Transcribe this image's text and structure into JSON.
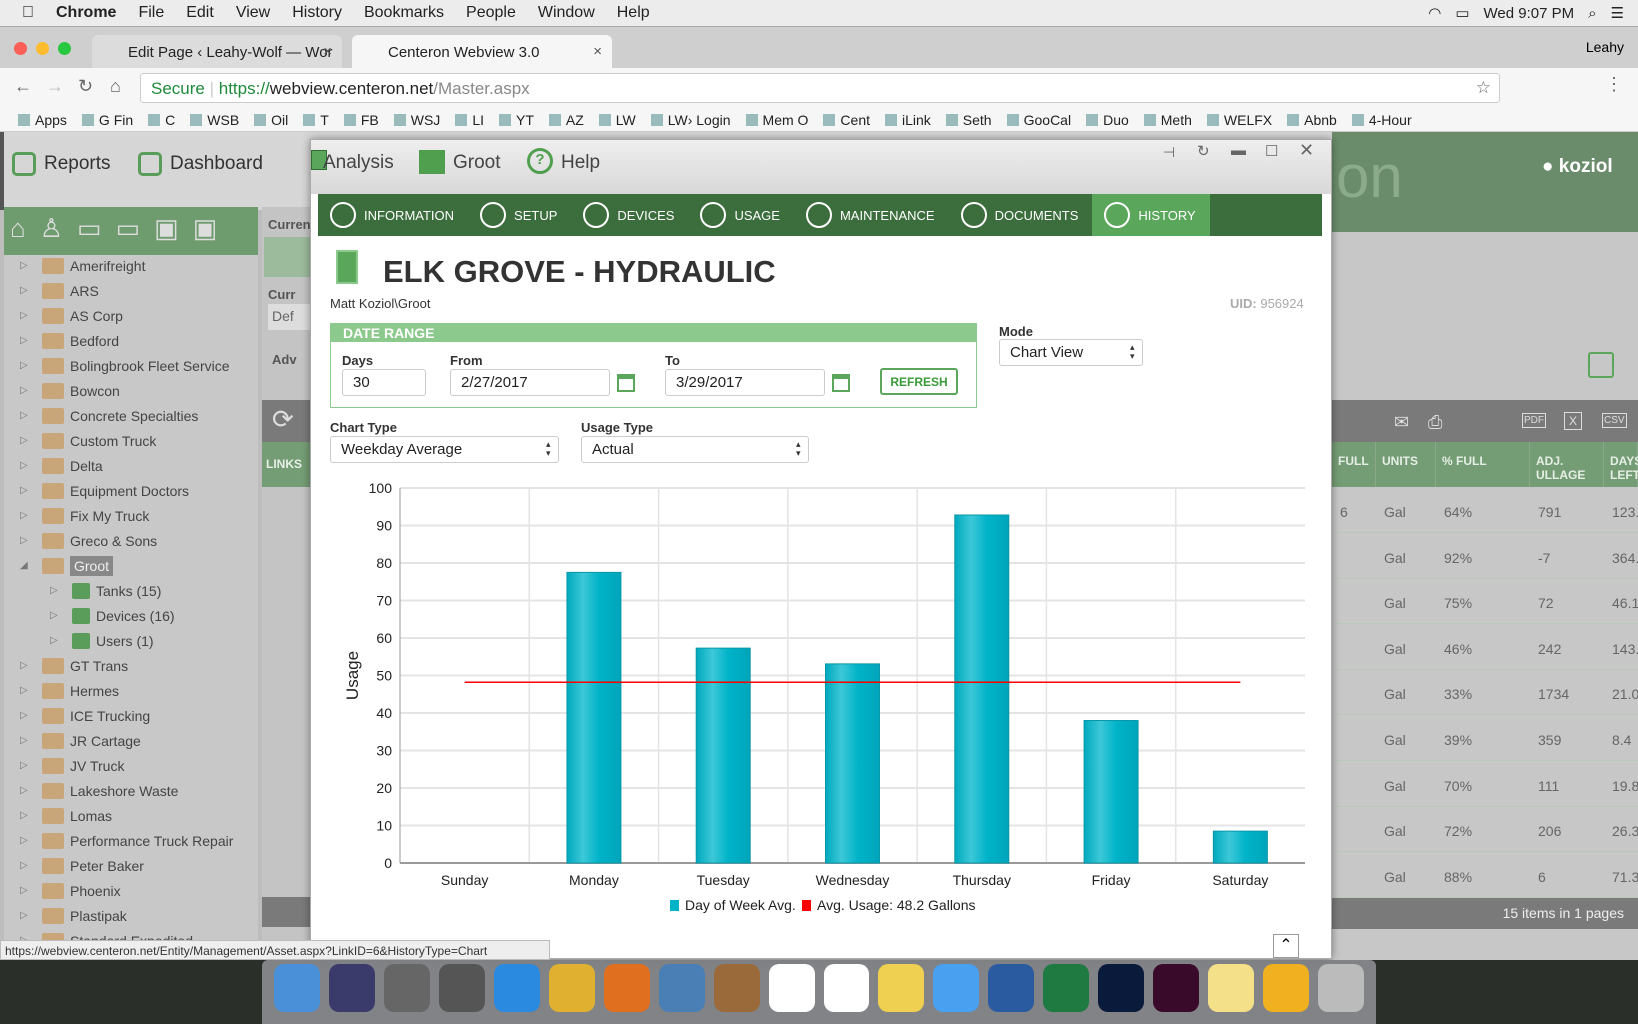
{
  "menubar": {
    "app": "Chrome",
    "items": [
      "File",
      "Edit",
      "View",
      "History",
      "Bookmarks",
      "People",
      "Window",
      "Help"
    ],
    "clock": "Wed 9:07 PM"
  },
  "browser": {
    "tabs": [
      {
        "title": "Edit Page ‹ Leahy-Wolf — Wor"
      },
      {
        "title": "Centeron Webview 3.0"
      }
    ],
    "profile": "Leahy",
    "secure_label": "Secure",
    "url_scheme": "https://",
    "url_host": "webview.centeron.net",
    "url_path": "/Master.aspx",
    "bookmarks": [
      "Apps",
      "G Fin",
      "C",
      "WSB",
      "Oil",
      "T",
      "FB",
      "WSJ",
      "LI",
      "YT",
      "AZ",
      "LW",
      "LW› Login",
      "Mem O",
      "Cent",
      "iLink",
      "Seth",
      "GooCal",
      "Duo",
      "Meth",
      "WELFX",
      "Abnb",
      "4-Hour"
    ],
    "status_url": "https://webview.centeron.net/Entity/Management/Asset.aspx?LinkID=6&HistoryType=Chart"
  },
  "app": {
    "nav": [
      "Reports",
      "Dashboard"
    ],
    "brand_partial": "on",
    "user": "koziol",
    "tree": [
      {
        "label": "Amerifreight"
      },
      {
        "label": "ARS"
      },
      {
        "label": "AS Corp"
      },
      {
        "label": "Bedford"
      },
      {
        "label": "Bolingbrook Fleet Service"
      },
      {
        "label": "Bowcon"
      },
      {
        "label": "Concrete Specialties"
      },
      {
        "label": "Custom Truck"
      },
      {
        "label": "Delta"
      },
      {
        "label": "Equipment Doctors"
      },
      {
        "label": "Fix My Truck"
      },
      {
        "label": "Greco & Sons"
      },
      {
        "label": "Groot",
        "selected": true
      },
      {
        "label": "Tanks (15)",
        "child": true
      },
      {
        "label": "Devices (16)",
        "child": true
      },
      {
        "label": "Users (1)",
        "child": true
      },
      {
        "label": "GT Trans"
      },
      {
        "label": "Hermes"
      },
      {
        "label": "ICE Trucking"
      },
      {
        "label": "JR Cartage"
      },
      {
        "label": "JV Truck"
      },
      {
        "label": "Lakeshore Waste"
      },
      {
        "label": "Lomas"
      },
      {
        "label": "Performance Truck Repair"
      },
      {
        "label": "Peter Baker"
      },
      {
        "label": "Phoenix"
      },
      {
        "label": "Plastipak"
      },
      {
        "label": "Standard Expedited"
      }
    ],
    "mid": {
      "current": "Curren",
      "curr2": "Curr",
      "def": "Def",
      "adv": "Adv",
      "links": "LINKS"
    },
    "grid": {
      "headers": [
        "FULL",
        "UNITS",
        "% FULL",
        "ADJ. ULLAGE",
        "DAYS LEFT"
      ],
      "rows": [
        [
          "6",
          "Gal",
          "64%",
          "791",
          "123."
        ],
        [
          "",
          "Gal",
          "92%",
          "-7",
          "364."
        ],
        [
          "",
          "Gal",
          "75%",
          "72",
          "46.1"
        ],
        [
          "",
          "Gal",
          "46%",
          "242",
          "143."
        ],
        [
          "",
          "Gal",
          "33%",
          "1734",
          "21.0"
        ],
        [
          "",
          "Gal",
          "39%",
          "359",
          "8.4"
        ],
        [
          "",
          "Gal",
          "70%",
          "111",
          "19.8"
        ],
        [
          "",
          "Gal",
          "72%",
          "206",
          "26.3"
        ],
        [
          "",
          "Gal",
          "88%",
          "6",
          "71.3"
        ]
      ],
      "footer": "15 items in 1 pages",
      "export": [
        "PDF",
        "X",
        "CSV"
      ]
    }
  },
  "modal": {
    "behind_nav": [
      "Analysis",
      "Groot",
      "Help"
    ],
    "tabs": [
      "INFORMATION",
      "SETUP",
      "DEVICES",
      "USAGE",
      "MAINTENANCE",
      "DOCUMENTS",
      "HISTORY"
    ],
    "active_tab": "HISTORY",
    "title": "ELK GROVE - HYDRAULIC",
    "path": "Matt Koziol\\Groot",
    "uid_label": "UID:",
    "uid": "956924",
    "date_range": {
      "header": "DATE RANGE",
      "days_label": "Days",
      "days": "30",
      "from_label": "From",
      "from": "2/27/2017",
      "to_label": "To",
      "to": "3/29/2017",
      "refresh": "REFRESH"
    },
    "mode_label": "Mode",
    "mode": "Chart View",
    "chart_type_label": "Chart Type",
    "chart_type": "Weekday Average",
    "usage_type_label": "Usage Type",
    "usage_type": "Actual"
  },
  "chart_data": {
    "type": "bar",
    "categories": [
      "Sunday",
      "Monday",
      "Tuesday",
      "Wednesday",
      "Thursday",
      "Friday",
      "Saturday"
    ],
    "series": [
      {
        "name": "Day of Week Avg.",
        "values": [
          0,
          77.5,
          57.3,
          53.1,
          92.8,
          38,
          8.5
        ],
        "color": "#00b3c8"
      }
    ],
    "reference_line": {
      "name": "Avg. Usage: 48.2 Gallons",
      "value": 48.2,
      "color": "#ff0000"
    },
    "ylabel": "Usage",
    "xlabel": "",
    "ylim": [
      0,
      100
    ],
    "yticks": [
      0,
      10,
      20,
      30,
      40,
      50,
      60,
      70,
      80,
      90,
      100
    ],
    "grid": true,
    "legend": "bottom"
  }
}
